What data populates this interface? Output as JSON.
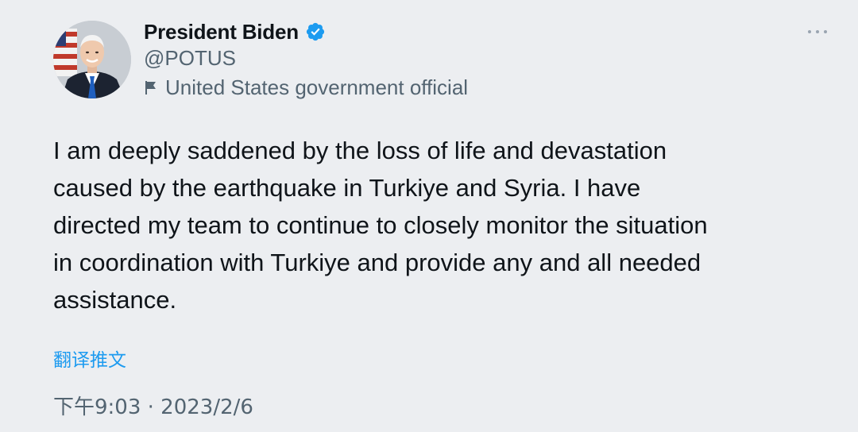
{
  "author": {
    "display_name": "President Biden",
    "handle": "@POTUS",
    "affiliation": "United States government official",
    "verified_icon": "verified-badge-icon",
    "affiliation_icon": "flag-icon"
  },
  "tweet": {
    "text": "I am deeply saddened by the loss of life and devastation\ncaused by the earthquake in Turkiye and Syria. I have\ndirected my team to continue to closely monitor the situation\nin coordination with Turkiye and provide any and all needed\nassistance.",
    "translate_label": "翻译推文",
    "timestamp": "下午9:03 · 2023/2/6"
  },
  "menu": {
    "more_icon": "more-options-icon"
  },
  "colors": {
    "background": "#eceef1",
    "primary_text": "#0f1419",
    "secondary_text": "#536471",
    "link": "#1d9bf0",
    "verified": "#1d9bf0"
  }
}
